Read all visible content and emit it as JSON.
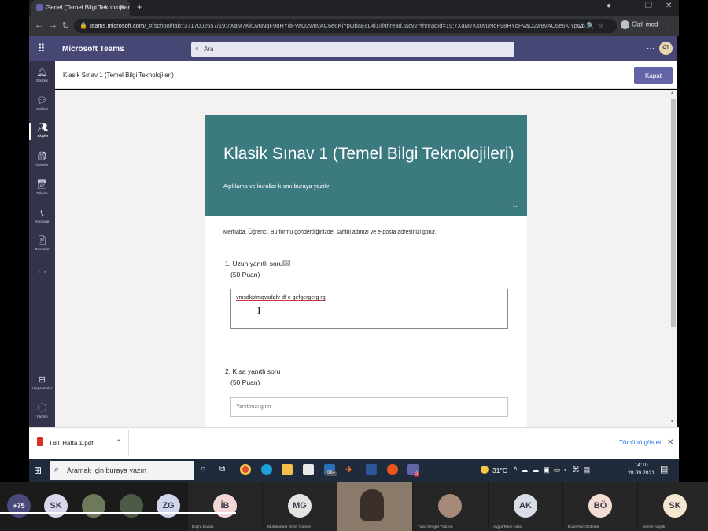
{
  "browser": {
    "tab_title": "Genel (Temel Bilgi Teknolojileri) | M",
    "new_tab": "+",
    "url_host": "teams.microsoft.com",
    "url_rest": "/_#/school/tab::3717002657/19:7XaM7Kk0vuNqF98HYdFVaO2w8vAC6e6KlYpObaEcL4l1@thread.tacv2?threadId=19:7XaM7Kk0vuNqF98HYdFVaO2w8vAC6e6KlYpOb...",
    "incognito_label": "Gizli mod"
  },
  "teams": {
    "title": "Microsoft Teams",
    "search_placeholder": "Ara",
    "more": "···",
    "user_initials": "ÖT"
  },
  "rail": {
    "items": [
      {
        "label": "Etkinlik",
        "icon": "bell-icon"
      },
      {
        "label": "Sohbet",
        "icon": "chat-icon"
      },
      {
        "label": "Ekipler",
        "icon": "teams-icon"
      },
      {
        "label": "Ödevler",
        "icon": "assignments-icon"
      },
      {
        "label": "Takvim",
        "icon": "calendar-icon"
      },
      {
        "label": "Aramalar",
        "icon": "phone-icon"
      },
      {
        "label": "Dosyalar",
        "icon": "files-icon"
      }
    ],
    "more": "···",
    "apps_label": "Uygulamalar",
    "help_label": "Yardım"
  },
  "app_header": {
    "title": "Klasik Sınav 1 (Temel Bilgi Teknolojileri)",
    "close_label": "Kapat"
  },
  "form": {
    "title": "Klasik Sınav 1 (Temel Bilgi Teknolojileri)",
    "description": "Açıklama ve kurallar kısmı buraya yazılır",
    "header_more": "···",
    "greeting": "Merhaba, Öğrenci. Bu formu gönderdiğinizde, sahibi adınızı ve e-posta adresinizi görür.",
    "q1": {
      "title": "1. Uzun yanıtlı soru",
      "points": "(50 Puan)",
      "answer": "vmsdkpfmqvsdafv df e gefgergerg rg"
    },
    "q2": {
      "title": "2. Kısa yanıtlı soru",
      "points": "(50 Puan)",
      "placeholder": "Yanıtınızı girin"
    }
  },
  "download": {
    "file_name": "TBT Hafta 1.pdf",
    "show_all": "Tümünü göster"
  },
  "taskbar": {
    "search_placeholder": "Aramak için buraya yazın",
    "badge": "99+",
    "teams_badge": "2",
    "temperature": "31°C",
    "time": "14:10",
    "date": "28.09.2021"
  },
  "participants": [
    {
      "initials": "+75",
      "color": "#4a4a7a"
    },
    {
      "initials": "SK",
      "color": "#d9d6ea"
    },
    {
      "initials": "",
      "color": "#6d7a5a"
    },
    {
      "initials": "",
      "color": "#4d5a45"
    },
    {
      "initials": "ZG",
      "color": "#cfd6ea"
    },
    {
      "initials": "İB",
      "name": "Büşra Babak",
      "color": "#f3d6d6"
    },
    {
      "initials": "MG",
      "name": "Muhammed Ömer Güleşli",
      "color": "#e6e3e3"
    },
    {
      "initials": "",
      "name": "",
      "color": "#8a7a6a"
    },
    {
      "initials": "",
      "name": "Tuba Sevgül Yıldırım",
      "color": "#a58a78"
    },
    {
      "initials": "AK",
      "name": "Aygül Tekin Kakır",
      "color": "#d9dde8"
    },
    {
      "initials": "BÖ",
      "name": "Buse Nur Özdemir",
      "color": "#f3dcd3"
    },
    {
      "initials": "SK",
      "name": "Semih Küçük",
      "color": "#f5e6cf"
    }
  ]
}
